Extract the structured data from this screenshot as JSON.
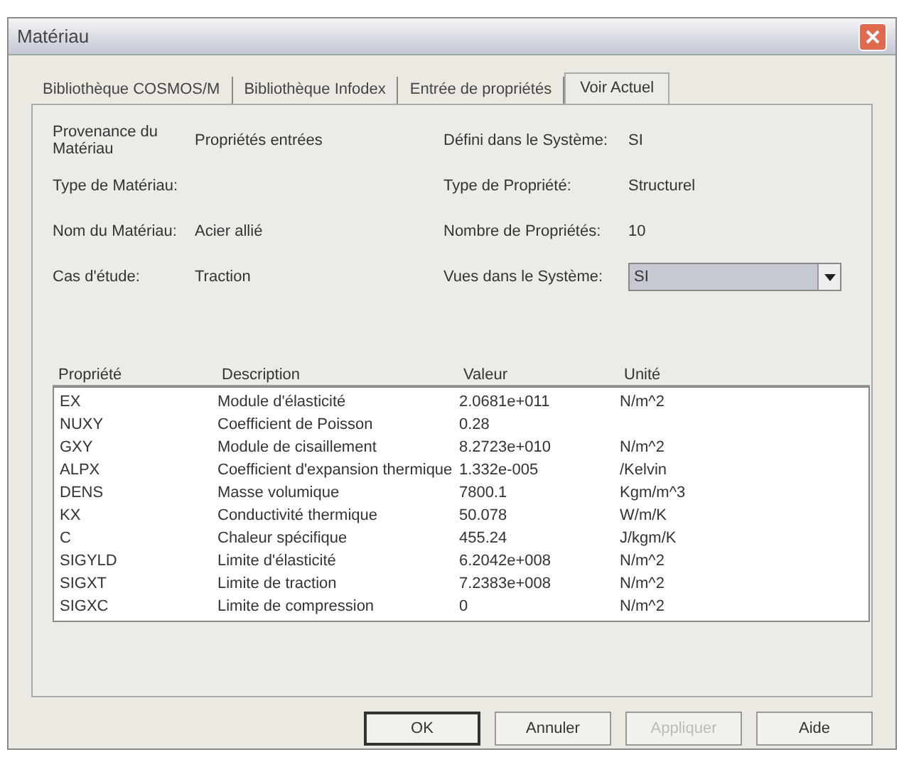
{
  "window": {
    "title": "Matériau"
  },
  "tabs": [
    {
      "label": "Bibliothèque COSMOS/M",
      "selected": false
    },
    {
      "label": "Bibliothèque Infodex",
      "selected": false
    },
    {
      "label": "Entrée de propriétés",
      "selected": false
    },
    {
      "label": "Voir Actuel",
      "selected": true
    }
  ],
  "info_left": [
    {
      "label": "Provenance du Matériau",
      "value": "Propriétés entrées"
    },
    {
      "label": "Type de Matériau:"
    },
    {
      "label": "Nom du Matériau:",
      "value": "Acier allié"
    },
    {
      "label": "Cas d'étude:",
      "value": "Traction"
    }
  ],
  "info_right": [
    {
      "label": "Défini dans le Système:",
      "value": "SI"
    },
    {
      "label": "Type de Propriété:",
      "value": "Structurel"
    },
    {
      "label": "Nombre de Propriétés:",
      "value": "10"
    }
  ],
  "view_system": {
    "label": "Vues dans le Système:",
    "value": "SI"
  },
  "table": {
    "columns": [
      "Propriété",
      "Description",
      "Valeur",
      "Unité"
    ],
    "rows": [
      [
        "EX",
        "Module d'élasticité",
        "2.0681e+011",
        "N/m^2"
      ],
      [
        "NUXY",
        "Coefficient de Poisson",
        "0.28",
        null
      ],
      [
        "GXY",
        "Module de cisaillement",
        "8.2723e+010",
        "N/m^2"
      ],
      [
        "ALPX",
        "Coefficient d'expansion thermique",
        "1.332e-005",
        "/Kelvin"
      ],
      [
        "DENS",
        "Masse volumique",
        "7800.1",
        "Kgm/m^3"
      ],
      [
        "KX",
        "Conductivité thermique",
        "50.078",
        "W/m/K"
      ],
      [
        "C",
        "Chaleur spécifique",
        "455.24",
        "J/kgm/K"
      ],
      [
        "SIGYLD",
        "Limite d'élasticité",
        "6.2042e+008",
        "N/m^2"
      ],
      [
        "SIGXT",
        "Limite de traction",
        "7.2383e+008",
        "N/m^2"
      ],
      [
        "SIGXC",
        "Limite de compression",
        "0",
        "N/m^2"
      ]
    ]
  },
  "buttons": [
    {
      "label": "OK",
      "default": true,
      "disabled": false
    },
    {
      "label": "Annuler",
      "default": false,
      "disabled": false
    },
    {
      "label": "Appliquer",
      "default": false,
      "disabled": true
    },
    {
      "label": "Aide",
      "default": false,
      "disabled": false
    }
  ]
}
